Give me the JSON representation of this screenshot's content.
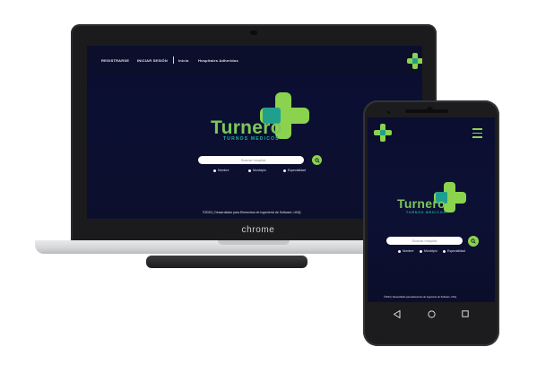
{
  "site": {
    "nav": {
      "register": "REGISTRARSE",
      "login": "INICIAR SESIÓN",
      "home": "Inicio",
      "hospitals": "Hospitales Adheridos"
    },
    "brand": {
      "name": "Turnero",
      "tagline": "TURNOS MEDICOS"
    },
    "search": {
      "placeholder": "Buscar hospital"
    },
    "filters": [
      "Nombre",
      "Municipio",
      "Especialidad"
    ],
    "footer": "©2023 | Desarrollado para Elementos de Ingeniería de Software, UNQ."
  },
  "laptop": {
    "browser_label": "chrome"
  },
  "phone": {
    "navbar": {
      "back_icon": "back-triangle-icon",
      "home_icon": "home-circle-icon",
      "recents_icon": "recents-square-icon"
    }
  },
  "colors": {
    "accent_green": "#8bd34e",
    "accent_teal": "#1fb3a3",
    "screen_bg": "#0b0f33"
  }
}
